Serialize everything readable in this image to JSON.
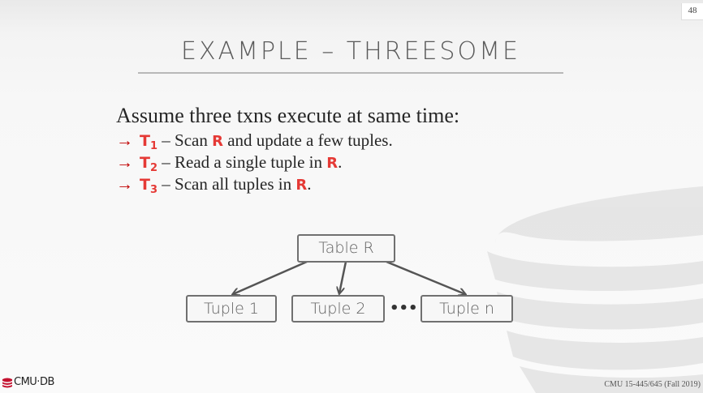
{
  "page_number": "48",
  "title": "EXAMPLE – THREESOME",
  "intro": "Assume three txns execute at same time:",
  "bullets": [
    {
      "arrow": "→",
      "txn": "T",
      "sub": "1",
      "text1": " – Scan ",
      "hl": "R",
      "text2": " and update a few tuples."
    },
    {
      "arrow": "→",
      "txn": "T",
      "sub": "2",
      "text1": " – Read a single tuple in ",
      "hl": "R",
      "text2": "."
    },
    {
      "arrow": "→",
      "txn": "T",
      "sub": "3",
      "text1": " – Scan all tuples in ",
      "hl": "R",
      "text2": "."
    }
  ],
  "diagram": {
    "root": "Table R",
    "children": [
      "Tuple 1",
      "Tuple 2",
      "Tuple n"
    ],
    "ellipsis": "•••"
  },
  "logo": "CMU·DB",
  "footer": "CMU 15-445/645 (Fall 2019)",
  "colors": {
    "highlight": "#e53935",
    "arrow": "#c00000",
    "box_border": "#707070"
  }
}
